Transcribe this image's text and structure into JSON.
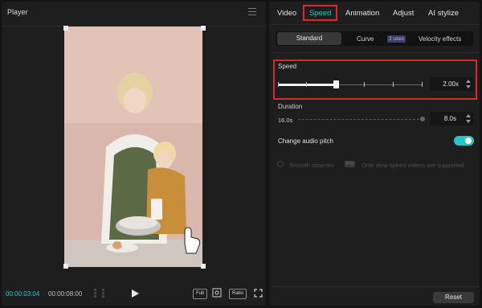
{
  "player": {
    "title": "Player",
    "current_time": "00:00:03:04",
    "total_time": "00:00:08:00",
    "full_label": "Full",
    "ratio_label": "Ratio"
  },
  "tabs": [
    "Video",
    "Speed",
    "Animation",
    "Adjust",
    "AI stylize"
  ],
  "active_tab": "Speed",
  "segments": {
    "standard": "Standard",
    "curve": "Curve",
    "curve_badge": "2 uses",
    "velocity": "Velocity effects"
  },
  "speed": {
    "label": "Speed",
    "value": "2.00x",
    "slider_fraction": 0.4
  },
  "duration": {
    "label": "Duration",
    "start": "16.0s",
    "value": "8.0s"
  },
  "audio_pitch": {
    "label": "Change audio pitch",
    "enabled": true
  },
  "slowmo": {
    "label": "Smooth slow-mo",
    "badge": "Pro",
    "note": "Only slow-speed videos are supported"
  },
  "reset_label": "Reset",
  "colors": {
    "accent": "#22c7c7",
    "highlight": "#e0262b",
    "panel": "#1e1e1e"
  }
}
